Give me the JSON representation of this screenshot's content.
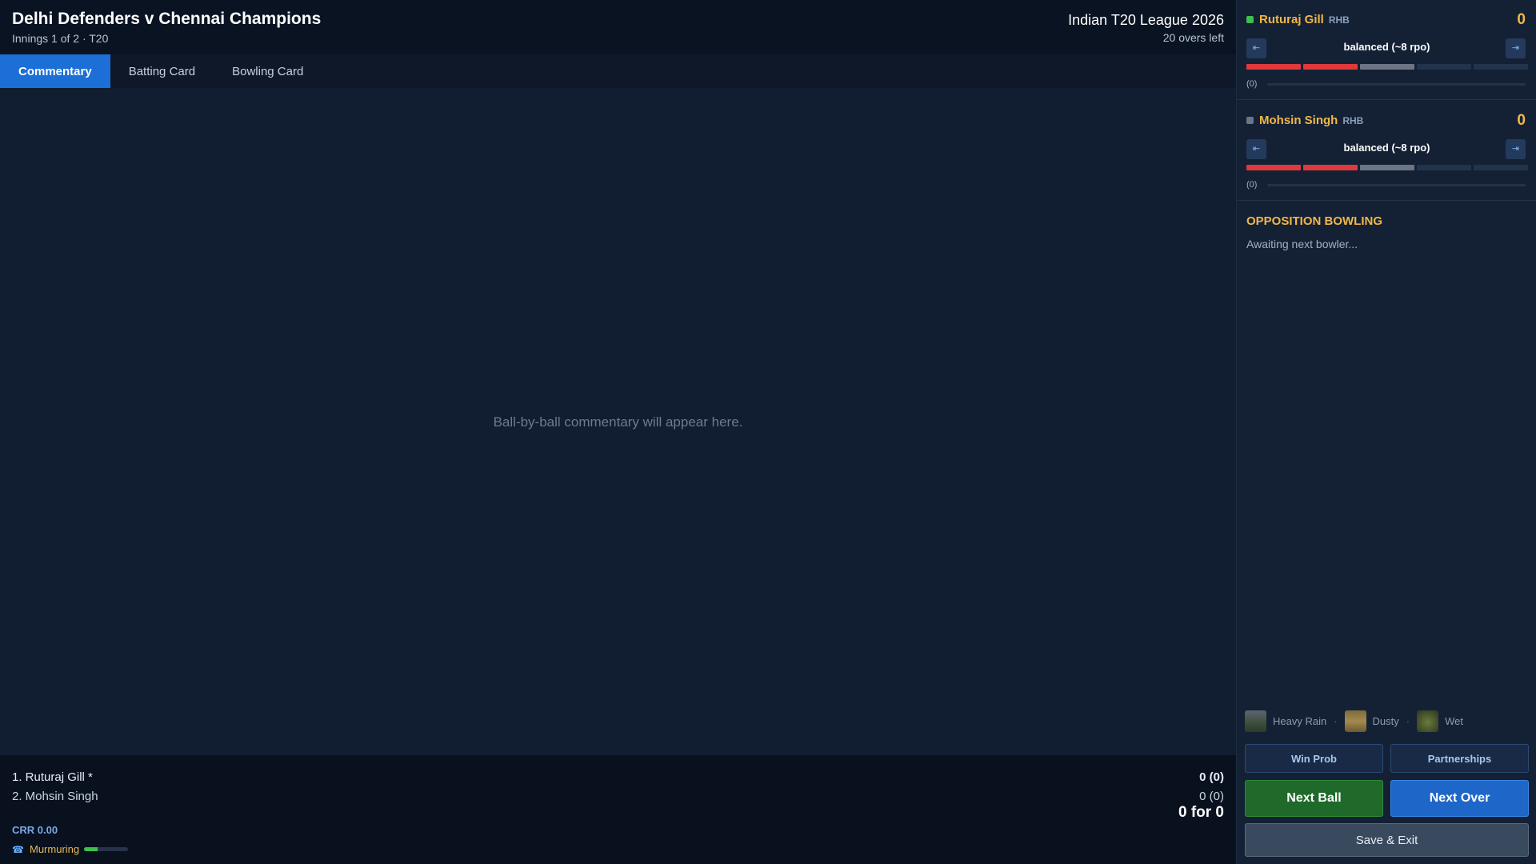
{
  "header": {
    "match_title": "Delhi Defenders v Chennai Champions",
    "innings_info": "Innings 1 of 2 · T20",
    "league": "Indian T20 League 2026",
    "overs_left": "20 overs left"
  },
  "tabs": [
    {
      "label": "Commentary",
      "active": true
    },
    {
      "label": "Batting Card",
      "active": false
    },
    {
      "label": "Bowling Card",
      "active": false
    }
  ],
  "commentary": {
    "empty_message": "Ball-by-ball commentary will appear here."
  },
  "scoreboard": {
    "batters": [
      {
        "label": "1. Ruturaj Gill *",
        "score": "0 (0)"
      },
      {
        "label": "2. Mohsin Singh",
        "score": "0 (0)"
      }
    ],
    "total": "0 for 0",
    "crr": "CRR 0.00",
    "crowd_mood": {
      "label": "Murmuring",
      "level": 0.3,
      "icon": "crowd-icon"
    }
  },
  "batter_panels": [
    {
      "name": "Ruturaj Gill",
      "hand": "RHB",
      "runs": "0",
      "on_strike": true,
      "status_color": "#3fbf4f",
      "mode": "balanced (~8 rpo)",
      "count": "(0)",
      "aggression_segments": [
        "#e0393b",
        "#e0393b",
        "#6b7585",
        "#22334c",
        "#22334c"
      ]
    },
    {
      "name": "Mohsin Singh",
      "hand": "RHB",
      "runs": "0",
      "on_strike": false,
      "status_color": "#6b7585",
      "mode": "balanced (~8 rpo)",
      "count": "(0)",
      "aggression_segments": [
        "#e0393b",
        "#e0393b",
        "#6b7585",
        "#22334c",
        "#22334c"
      ]
    }
  ],
  "opposition": {
    "title": "OPPOSITION BOWLING",
    "status": "Awaiting next bowler..."
  },
  "conditions": [
    {
      "label": "Heavy Rain",
      "icon": "heavy-rain-icon"
    },
    {
      "label": "Dusty",
      "icon": "dusty-pitch-icon"
    },
    {
      "label": "Wet",
      "icon": "wet-outfield-icon"
    }
  ],
  "condition_separator": "·",
  "buttons": {
    "win_prob": "Win Prob",
    "partnerships": "Partnerships",
    "next_ball": "Next Ball",
    "next_over": "Next Over",
    "save_exit": "Save & Exit"
  },
  "colors": {
    "accent": "#1c6fd6",
    "gold": "#f2b746",
    "next_ball": "#1f6a2a",
    "next_over": "#1f66c9"
  }
}
